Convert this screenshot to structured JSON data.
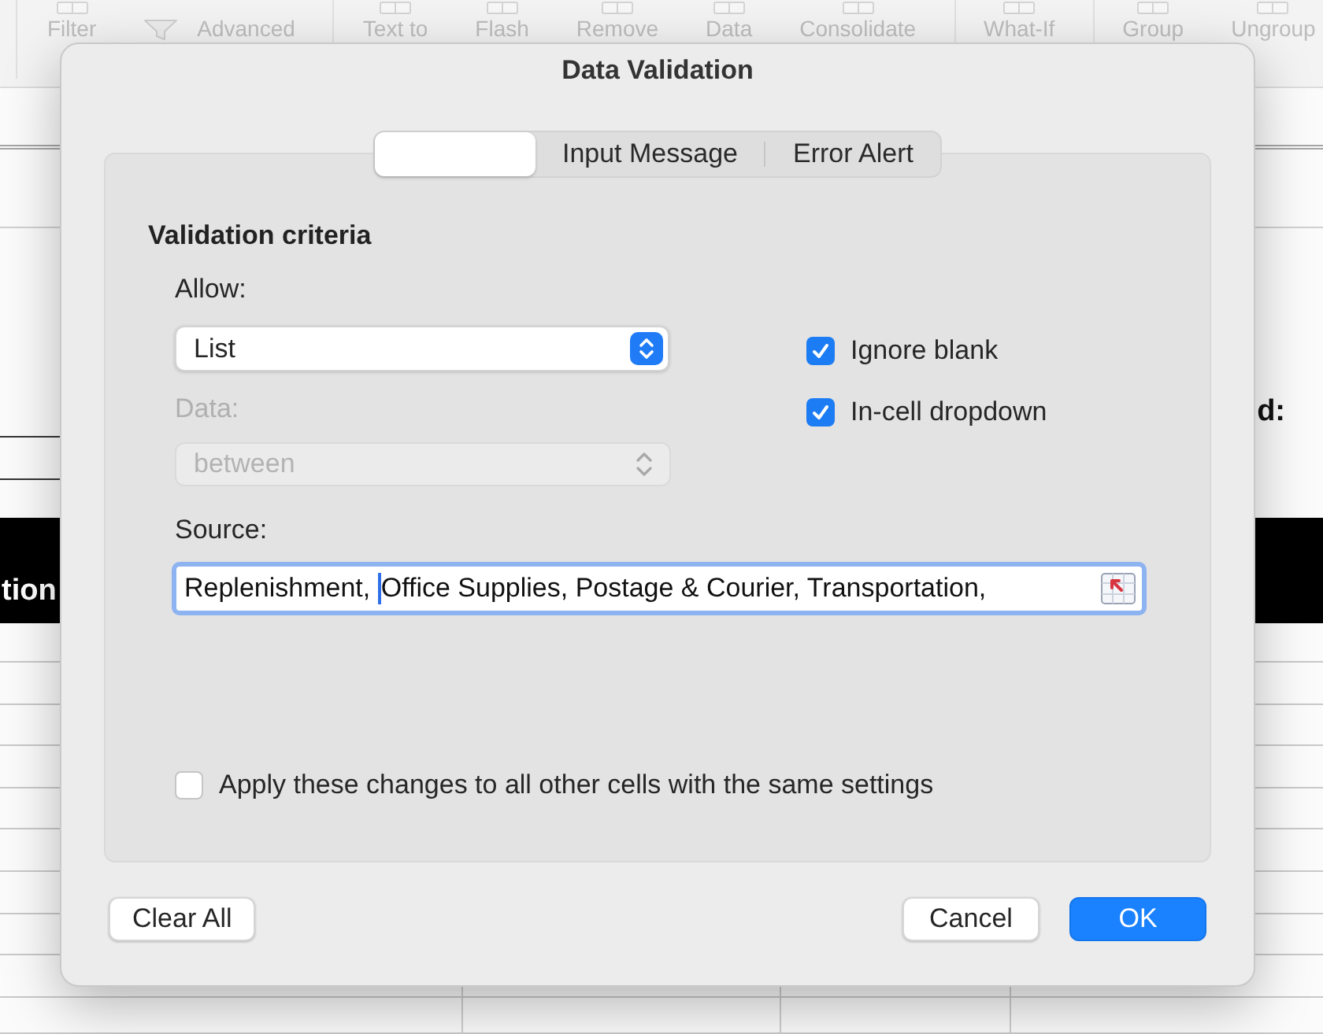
{
  "ribbon": {
    "groups": [
      {
        "items": [
          {
            "label": "Filter",
            "kind": "large"
          },
          {
            "label": "Advanced",
            "kind": "small"
          }
        ]
      },
      {
        "items": [
          {
            "label": "Text to",
            "kind": "large"
          },
          {
            "label": "Flash",
            "kind": "large"
          },
          {
            "label": "Remove",
            "kind": "large"
          },
          {
            "label": "Data",
            "kind": "large"
          },
          {
            "label": "Consolidate",
            "kind": "large"
          }
        ]
      },
      {
        "items": [
          {
            "label": "What-If",
            "kind": "large"
          }
        ]
      },
      {
        "items": [
          {
            "label": "Group",
            "kind": "large"
          },
          {
            "label": "Ungroup",
            "kind": "large"
          }
        ]
      }
    ]
  },
  "sheet": {
    "cell_text": "d:",
    "header_band": {
      "text": "tion"
    }
  },
  "dialog": {
    "title": "Data Validation",
    "tabs": [
      {
        "selected": true
      },
      {
        "label": "Input Message",
        "selected": false
      },
      {
        "label": "Error Alert",
        "selected": false
      }
    ],
    "section_title": "Validation criteria",
    "allow": {
      "label": "Allow:",
      "value": "List",
      "disabled": false
    },
    "data": {
      "label": "Data:",
      "value": "between",
      "disabled": true
    },
    "options": [
      {
        "label": "Ignore blank",
        "checked": true
      },
      {
        "label": "In-cell dropdown",
        "checked": true
      }
    ],
    "source": {
      "label": "Source:",
      "value_before_cursor": "Replenishment, ",
      "value_after_cursor": "Office Supplies, Postage & Courier, Transportation,",
      "focused": true
    },
    "apply_to_all": {
      "label": "Apply these changes to all other cells with the same settings",
      "checked": false
    },
    "buttons": [
      {
        "label": "Clear All",
        "kind": "reset"
      },
      {
        "label": "Cancel",
        "kind": "cancel"
      },
      {
        "label": "OK",
        "kind": "default"
      }
    ]
  }
}
